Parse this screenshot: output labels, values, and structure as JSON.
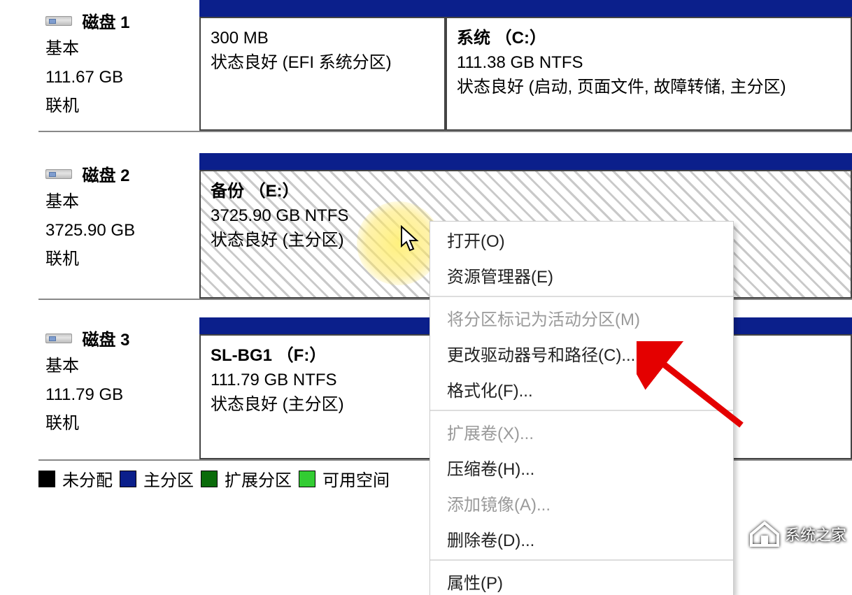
{
  "disks": [
    {
      "name": "磁盘 1",
      "type": "基本",
      "size": "111.67 GB",
      "status": "联机",
      "parts": [
        {
          "title": "",
          "size": "300 MB",
          "state": "状态良好 (EFI 系统分区)"
        },
        {
          "title": "系统 （C:）",
          "size": "111.38 GB NTFS",
          "state": "状态良好 (启动, 页面文件, 故障转储, 主分区)"
        }
      ]
    },
    {
      "name": "磁盘 2",
      "type": "基本",
      "size": "3725.90 GB",
      "status": "联机",
      "parts": [
        {
          "title": "备份 （E:）",
          "size": "3725.90 GB NTFS",
          "state": "状态良好 (主分区)"
        }
      ]
    },
    {
      "name": "磁盘 3",
      "type": "基本",
      "size": "111.79 GB",
      "status": "联机",
      "parts": [
        {
          "title": "SL-BG1 （F:）",
          "size": "111.79 GB NTFS",
          "state": "状态良好 (主分区)"
        }
      ]
    }
  ],
  "legend": {
    "unallocated": "未分配",
    "primary": "主分区",
    "extended": "扩展分区",
    "free": "可用空间"
  },
  "menu": {
    "open": "打开(O)",
    "explorer": "资源管理器(E)",
    "mark_active": "将分区标记为活动分区(M)",
    "change_letter": "更改驱动器号和路径(C)...",
    "format": "格式化(F)...",
    "extend": "扩展卷(X)...",
    "shrink": "压缩卷(H)...",
    "mirror": "添加镜像(A)...",
    "delete": "删除卷(D)...",
    "props": "属性(P)"
  },
  "watermark": "系统之家"
}
